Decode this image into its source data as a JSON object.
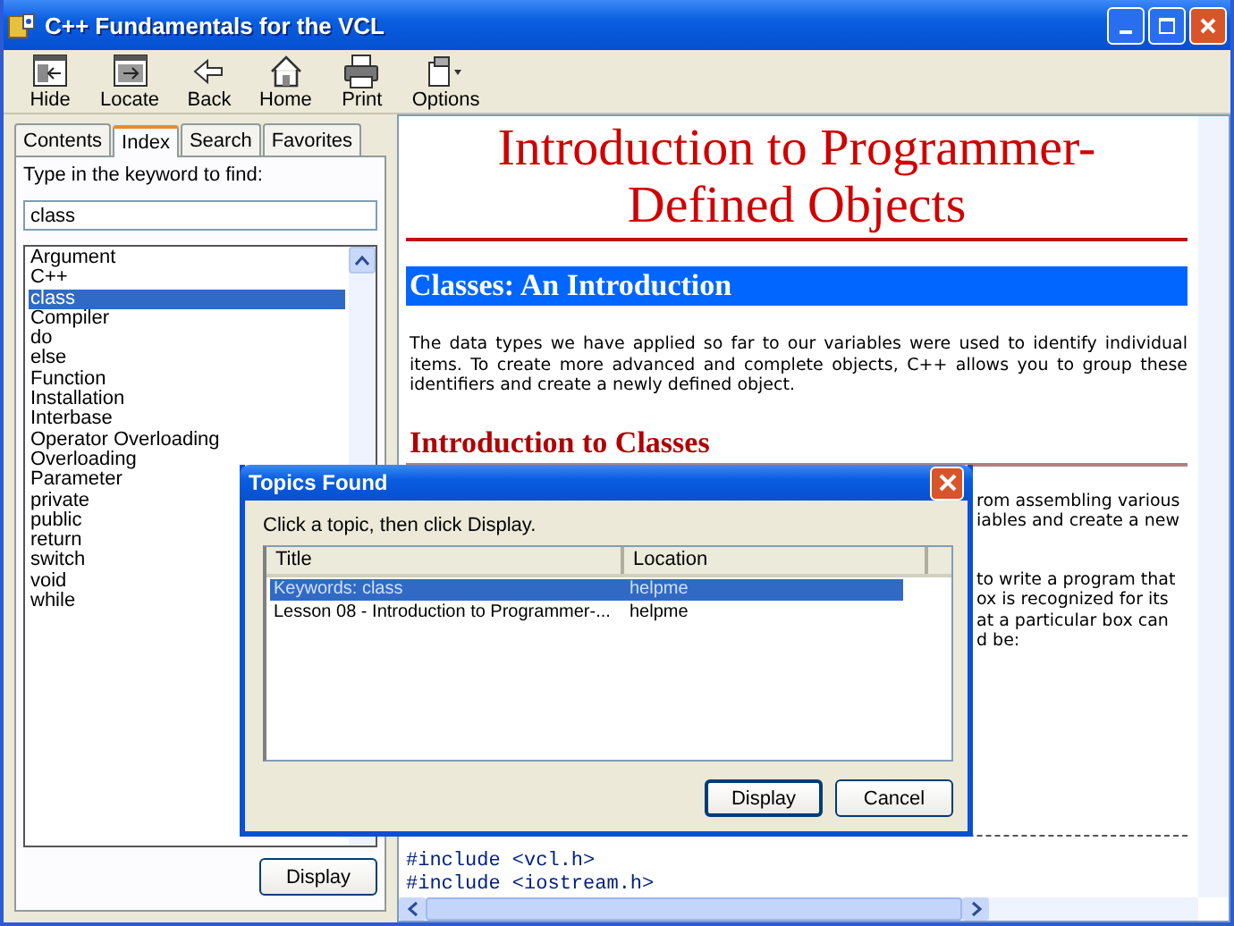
{
  "window": {
    "title": "C++ Fundamentals for the VCL"
  },
  "toolbar": [
    {
      "label": "Hide"
    },
    {
      "label": "Locate"
    },
    {
      "label": "Back"
    },
    {
      "label": "Home"
    },
    {
      "label": "Print"
    },
    {
      "label": "Options"
    }
  ],
  "tabs": [
    {
      "label": "Contents",
      "selected": false
    },
    {
      "label": "Index",
      "selected": true
    },
    {
      "label": "Search",
      "selected": false
    },
    {
      "label": "Favorites",
      "selected": false
    }
  ],
  "index": {
    "prompt": "Type in the keyword to find:",
    "keyword": "class",
    "items": [
      {
        "label": "Argument",
        "selected": false
      },
      {
        "label": "C++",
        "selected": false
      },
      {
        "label": "class",
        "selected": true
      },
      {
        "label": "Compiler",
        "selected": false
      },
      {
        "label": "do",
        "selected": false
      },
      {
        "label": "else",
        "selected": false
      },
      {
        "label": "Function",
        "selected": false
      },
      {
        "label": "Installation",
        "selected": false
      },
      {
        "label": "Interbase",
        "selected": false
      },
      {
        "label": "Operator Overloading",
        "selected": false
      },
      {
        "label": "Overloading",
        "selected": false
      },
      {
        "label": "Parameter",
        "selected": false
      },
      {
        "label": "private",
        "selected": false
      },
      {
        "label": "public",
        "selected": false
      },
      {
        "label": "return",
        "selected": false
      },
      {
        "label": "switch",
        "selected": false
      },
      {
        "label": "void",
        "selected": false
      },
      {
        "label": "while",
        "selected": false
      }
    ],
    "button": "Display"
  },
  "content": {
    "heading": "Introduction to Programmer-Defined Objects",
    "section_bar": "Classes: An Introduction",
    "paragraph": "The data types we have applied so far to our variables were used to identify individual items. To create more advanced and complete objects, C++ allows you to group these identifiers and create a newly defined object.",
    "subheading": "Introduction to Classes",
    "partial_paragraphs": [
      [
        "rom assembling various",
        "iables and create a new"
      ],
      [
        "to write a program that",
        "ox is recognized for its",
        "at a particular box can",
        "d be:"
      ]
    ],
    "code": [
      "#include <vcl.h>",
      "#include <iostream.h>"
    ]
  },
  "dialog": {
    "title": "Topics Found",
    "instruction": "Click a topic, then click Display.",
    "columns": [
      "Title",
      "Location"
    ],
    "rows": [
      {
        "title": "Keywords: class",
        "location": "helpme",
        "selected": true
      },
      {
        "title": "Lesson 08 - Introduction to Programmer-...",
        "location": "helpme",
        "selected": false
      }
    ],
    "buttons": [
      "Display",
      "Cancel"
    ]
  }
}
